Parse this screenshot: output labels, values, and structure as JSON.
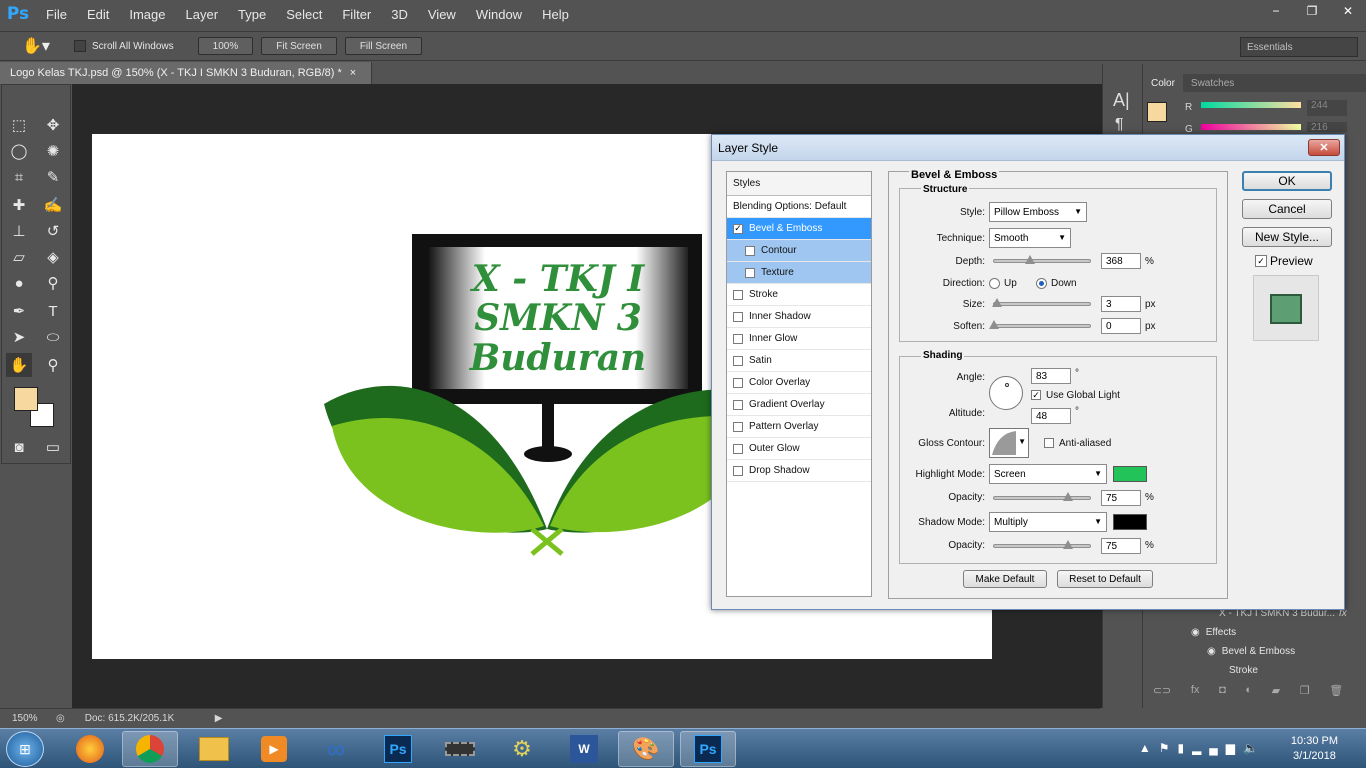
{
  "app": {
    "logo": "Ps",
    "menu": [
      "File",
      "Edit",
      "Image",
      "Layer",
      "Type",
      "Select",
      "Filter",
      "3D",
      "View",
      "Window",
      "Help"
    ],
    "window_controls": [
      "−",
      "❐",
      "✕"
    ]
  },
  "options_bar": {
    "scroll_all_label": "Scroll All Windows",
    "zoom_btn": "100%",
    "fit_btn": "Fit Screen",
    "fill_btn": "Fill Screen",
    "workspace": "Essentials"
  },
  "document": {
    "tab_title": "Logo Kelas TKJ.psd @ 150% (X - TKJ I SMKN 3 Buduran, RGB/8) *",
    "close": "×",
    "logo_text": [
      "X - TKJ I",
      "SMKN 3",
      "Buduran"
    ]
  },
  "status": {
    "zoom": "150%",
    "doc": "Doc: 615.2K/205.1K"
  },
  "colors": {
    "foreground": "#f7d9a0",
    "background": "#ffffff",
    "highlight": "#22c45a",
    "shadow": "#000000",
    "accent_green": "#2f8f3a"
  },
  "right_panel": {
    "tabs": [
      "Color",
      "Swatches"
    ],
    "r_label": "R",
    "g_label": "G",
    "r_value": "244",
    "g_value": "216",
    "layers": {
      "layer_name": "X - TKJ I SMKN 3 Budur...",
      "fx": "fx",
      "effects_label": "Effects",
      "bevel_label": "Bevel & Emboss",
      "stroke_label": "Stroke"
    }
  },
  "dialog": {
    "title": "Layer Style",
    "close": "✕",
    "styles": [
      {
        "label": "Styles",
        "kind": "header",
        "check": false
      },
      {
        "label": "Blending Options: Default",
        "kind": "plain",
        "check": false
      },
      {
        "label": "Bevel & Emboss",
        "kind": "selected",
        "check": true
      },
      {
        "label": "Contour",
        "kind": "sub",
        "check": false
      },
      {
        "label": "Texture",
        "kind": "sub",
        "check": false
      },
      {
        "label": "Stroke",
        "kind": "item",
        "check": false
      },
      {
        "label": "Inner Shadow",
        "kind": "item",
        "check": false
      },
      {
        "label": "Inner Glow",
        "kind": "item",
        "check": false
      },
      {
        "label": "Satin",
        "kind": "item",
        "check": false
      },
      {
        "label": "Color Overlay",
        "kind": "item",
        "check": false
      },
      {
        "label": "Gradient Overlay",
        "kind": "item",
        "check": false
      },
      {
        "label": "Pattern Overlay",
        "kind": "item",
        "check": false
      },
      {
        "label": "Outer Glow",
        "kind": "item",
        "check": false
      },
      {
        "label": "Drop Shadow",
        "kind": "item",
        "check": false
      }
    ],
    "section_title": "Bevel & Emboss",
    "structure_title": "Structure",
    "style_label": "Style:",
    "style_value": "Pillow Emboss",
    "technique_label": "Technique:",
    "technique_value": "Smooth",
    "depth_label": "Depth:",
    "depth_value": "368",
    "depth_level": 0.37,
    "percent": "%",
    "direction_label": "Direction:",
    "dir_up": "Up",
    "dir_down": "Down",
    "size_label": "Size:",
    "size_value": "3",
    "soften_label": "Soften:",
    "soften_value": "0",
    "px": "px",
    "shading_title": "Shading",
    "angle_label": "Angle:",
    "angle_value": "83",
    "degree": "°",
    "global_light_label": "Use Global Light",
    "altitude_label": "Altitude:",
    "altitude_value": "48",
    "gloss_label": "Gloss Contour:",
    "antialias_label": "Anti-aliased",
    "highlight_mode_label": "Highlight Mode:",
    "highlight_mode_value": "Screen",
    "h_opacity_label": "Opacity:",
    "h_opacity_value": "75",
    "opacity_level": 0.75,
    "shadow_mode_label": "Shadow Mode:",
    "shadow_mode_value": "Multiply",
    "s_opacity_label": "Opacity:",
    "s_opacity_value": "75",
    "make_default": "Make Default",
    "reset_default": "Reset to Default",
    "ok": "OK",
    "cancel": "Cancel",
    "new_style": "New Style...",
    "preview_label": "Preview"
  },
  "taskbar": {
    "time": "10:30 PM",
    "date": "3/1/2018"
  }
}
